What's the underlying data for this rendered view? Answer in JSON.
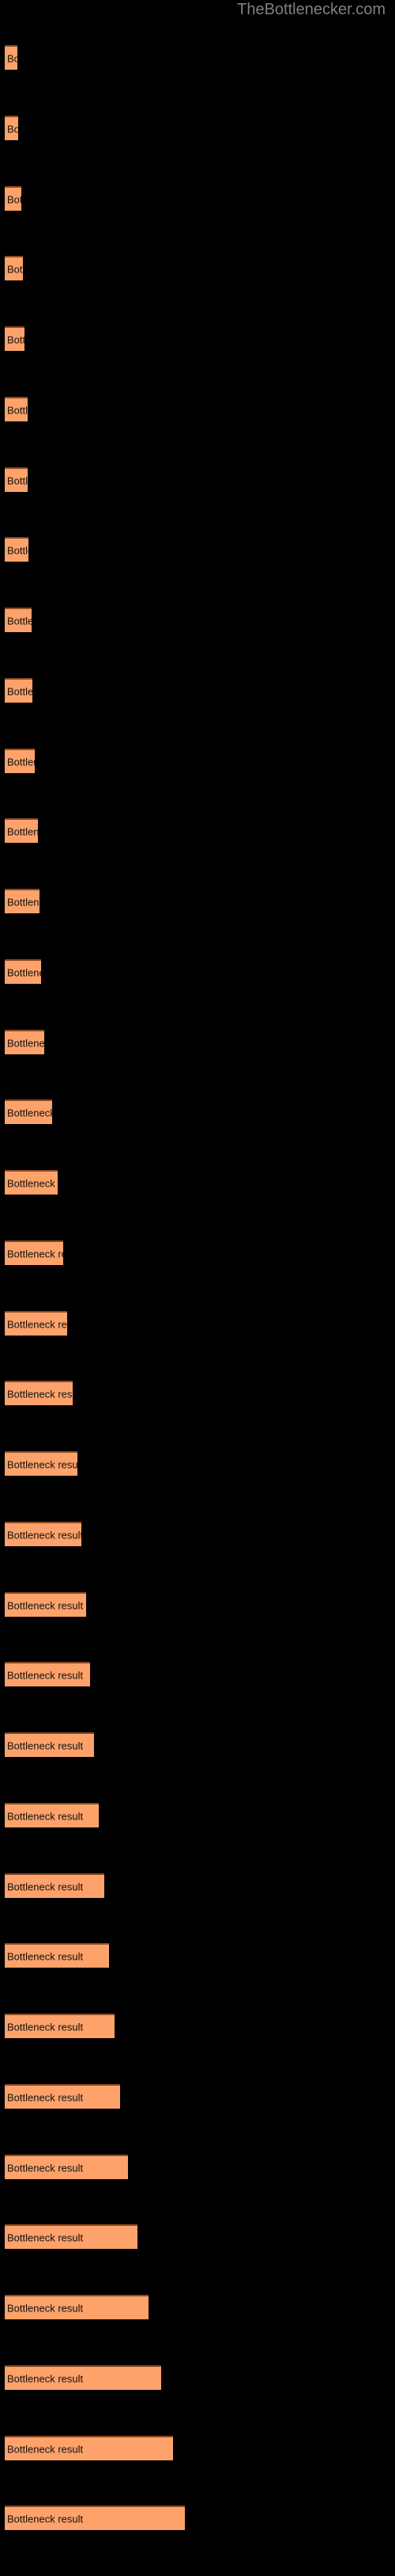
{
  "header": {
    "site_title": "TheBottlenecker.com",
    "title_color": "#808080"
  },
  "colors": {
    "background": "#000000",
    "bar_fill": "#FCA26A",
    "bar_border_top": "#8C4A20",
    "bar_label_text": "#121212",
    "title_text": "#808080"
  },
  "chart_data": {
    "type": "bar",
    "orientation": "horizontal",
    "title": "TheBottlenecker.com",
    "xlabel": "",
    "ylabel": "",
    "grid": false,
    "legend": false,
    "axis_visible": false,
    "tick_labels_visible": false,
    "xlim": [
      0,
      500
    ],
    "bar_label_text": "Bottleneck result",
    "bar_count": 36,
    "categories": [
      "Bottleneck result",
      "Bottleneck result",
      "Bottleneck result",
      "Bottleneck result",
      "Bottleneck result",
      "Bottleneck result",
      "Bottleneck result",
      "Bottleneck result",
      "Bottleneck result",
      "Bottleneck result",
      "Bottleneck result",
      "Bottleneck result",
      "Bottleneck result",
      "Bottleneck result",
      "Bottleneck result",
      "Bottleneck result",
      "Bottleneck result",
      "Bottleneck result",
      "Bottleneck result",
      "Bottleneck result",
      "Bottleneck result",
      "Bottleneck result",
      "Bottleneck result",
      "Bottleneck result",
      "Bottleneck result",
      "Bottleneck result",
      "Bottleneck result",
      "Bottleneck result",
      "Bottleneck result",
      "Bottleneck result",
      "Bottleneck result",
      "Bottleneck result",
      "Bottleneck result",
      "Bottleneck result",
      "Bottleneck result",
      "Bottleneck result"
    ],
    "values": [
      13,
      14,
      17,
      19,
      21,
      24,
      24,
      25,
      28,
      29,
      32,
      35,
      37,
      38,
      42,
      50,
      56,
      62,
      66,
      72,
      77,
      81,
      86,
      90,
      94,
      99,
      105,
      110,
      116,
      122,
      130,
      140,
      152,
      165,
      178,
      190
    ],
    "bar_pixel_widths": [
      16,
      17,
      21,
      23,
      25,
      29,
      29,
      30,
      34,
      35,
      38,
      42,
      44,
      46,
      50,
      60,
      67,
      74,
      79,
      86,
      92,
      97,
      103,
      108,
      113,
      119,
      126,
      132,
      139,
      146,
      156,
      168,
      182,
      198,
      213,
      228
    ],
    "bar_tops": [
      57,
      146,
      235,
      323,
      412,
      501,
      590,
      678,
      767,
      856,
      945,
      1033,
      1122,
      1211,
      1300,
      1388,
      1477,
      1566,
      1655,
      1743,
      1832,
      1921,
      2010,
      2098,
      2187,
      2276,
      2365,
      2453,
      2542,
      2631,
      2720,
      2808,
      2897,
      2986,
      3075,
      3163
    ]
  }
}
